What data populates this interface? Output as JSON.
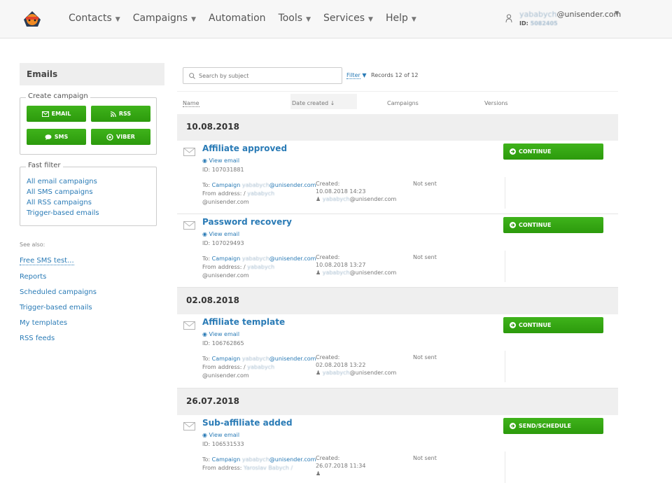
{
  "nav": {
    "items": [
      "Contacts",
      "Campaigns",
      "Automation",
      "Tools",
      "Services",
      "Help"
    ],
    "has_caret": [
      true,
      true,
      false,
      true,
      true,
      true
    ]
  },
  "account": {
    "email_blurred": "yababych",
    "email_domain": "@unisender.com",
    "id_label": "ID:",
    "id_value": "5082405"
  },
  "sidebar": {
    "title": "Emails",
    "create_legend": "Create campaign",
    "buttons": {
      "email": "EMAIL",
      "rss": "RSS",
      "sms": "SMS",
      "viber": "VIBER"
    },
    "fast_legend": "Fast filter",
    "fast_links": [
      "All email campaigns",
      "All SMS campaigns",
      "All RSS campaigns",
      "Trigger-based emails"
    ],
    "see_also": "See also:",
    "links": [
      "Free SMS test...",
      "Reports",
      "Scheduled campaigns",
      "Trigger-based emails",
      "My templates",
      "RSS feeds"
    ]
  },
  "toolbar": {
    "search_placeholder": "Search by subject",
    "filter": "Filter",
    "records": "Records 12 of 12"
  },
  "columns": {
    "name": "Name",
    "date": "Date created ↓",
    "campaigns": "Campaigns",
    "versions": "Versions"
  },
  "groups": [
    {
      "date": "10.08.2018"
    },
    {
      "date": "02.08.2018"
    },
    {
      "date": "26.07.2018"
    }
  ],
  "items": [
    {
      "title": "Affiliate approved",
      "view": "View email",
      "id": "ID: 107031881",
      "to_prefix": "To: ",
      "to_link": "Campaign",
      "to_blur": "yababych",
      "to_domain": "@unisender.com",
      "from_label": "From address: /",
      "from_blur": "yababych",
      "from_domain": "@unisender.com",
      "created_label": "Created:",
      "created_date": "10.08.2018 14:23",
      "created_blur": "yababych",
      "created_domain": "@unisender.com",
      "status": "Not sent",
      "action": "CONTINUE"
    },
    {
      "title": "Password recovery",
      "view": "View email",
      "id": "ID: 107029493",
      "to_prefix": "To: ",
      "to_link": "Campaign",
      "to_blur": "yababych",
      "to_domain": "@unisender.com",
      "from_label": "From address: /",
      "from_blur": "yababych",
      "from_domain": "@unisender.com",
      "created_label": "Created:",
      "created_date": "10.08.2018 13:27",
      "created_blur": "yababych",
      "created_domain": "@unisender.com",
      "status": "Not sent",
      "action": "CONTINUE"
    },
    {
      "title": "Affiliate template",
      "view": "View email",
      "id": "ID: 106762865",
      "to_prefix": "To: ",
      "to_link": "Campaign",
      "to_blur": "yababych",
      "to_domain": "@unisender.com",
      "from_label": "From address: /",
      "from_blur": "yababych",
      "from_domain": "@unisender.com",
      "created_label": "Created:",
      "created_date": "02.08.2018 13:22",
      "created_blur": "yababych",
      "created_domain": "@unisender.com",
      "status": "Not sent",
      "action": "CONTINUE"
    },
    {
      "title": "Sub-affiliate added",
      "view": "View email",
      "id": "ID: 106531533",
      "to_prefix": "To: ",
      "to_link": "Campaign",
      "to_blur": "yababych",
      "to_domain": "@unisender.com",
      "from_label": "From address:",
      "from_blur": "Yaroslav Babych /",
      "from_domain": "",
      "created_label": "Created:",
      "created_date": "26.07.2018 11:34",
      "created_blur": "",
      "created_domain": "",
      "status": "Not sent",
      "action": "SEND/SCHEDULE"
    }
  ],
  "colors": {
    "accent": "#2a7bb6",
    "button_green": "#36a812",
    "header_bg": "#f7f7f7"
  }
}
